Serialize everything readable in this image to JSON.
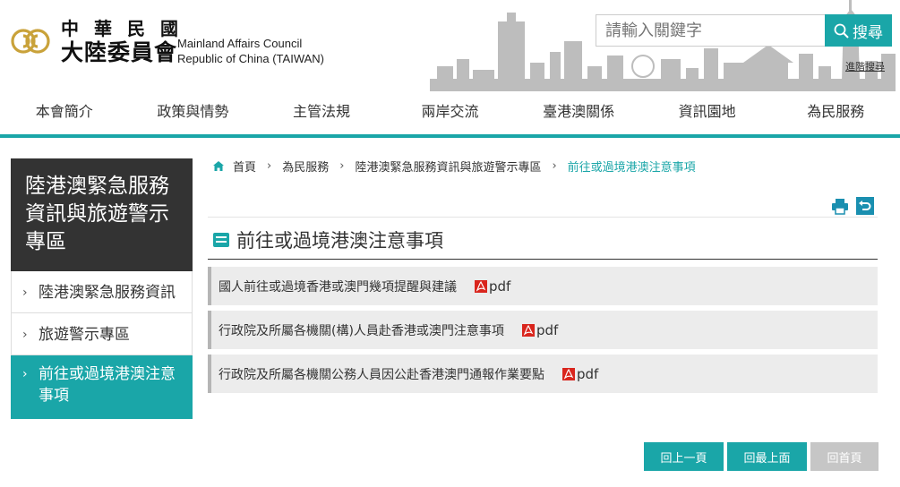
{
  "header": {
    "cn_line1": "中華民國",
    "cn_line2": "大陸委員會",
    "en_line1": "Mainland Affairs Council",
    "en_line2": "Republic of China (TAIWAN)",
    "search_placeholder": "請輸入關鍵字",
    "search_label": "搜尋",
    "advanced_search": "進階搜尋"
  },
  "nav": [
    "本會簡介",
    "政策與情勢",
    "主管法規",
    "兩岸交流",
    "臺港澳關係",
    "資訊園地",
    "為民服務"
  ],
  "sidebar": {
    "title": "陸港澳緊急服務資訊與旅遊警示專區",
    "items": [
      {
        "label": "陸港澳緊急服務資訊"
      },
      {
        "label": "旅遊警示專區"
      },
      {
        "label": "前往或過境港澳注意事項"
      }
    ]
  },
  "breadcrumb": [
    "首頁",
    "為民服務",
    "陸港澳緊急服務資訊與旅遊警示專區",
    "前往或過境港澳注意事項"
  ],
  "page_title": "前往或過境港澳注意事項",
  "documents": [
    {
      "title": "國人前往或過境香港或澳門幾項提醒與建議",
      "file": "pdf"
    },
    {
      "title": "行政院及所屬各機關(構)人員赴香港或澳門注意事項",
      "file": "pdf"
    },
    {
      "title": "行政院及所屬各機關公務人員因公赴香港澳門通報作業要點",
      "file": "pdf"
    }
  ],
  "bottom": {
    "back": "回上一頁",
    "top": "回最上面",
    "home": "回首頁"
  },
  "colors": {
    "accent": "#1aa6a8",
    "sidebar_title_bg": "#333333",
    "pdf_red": "#d9251d"
  }
}
